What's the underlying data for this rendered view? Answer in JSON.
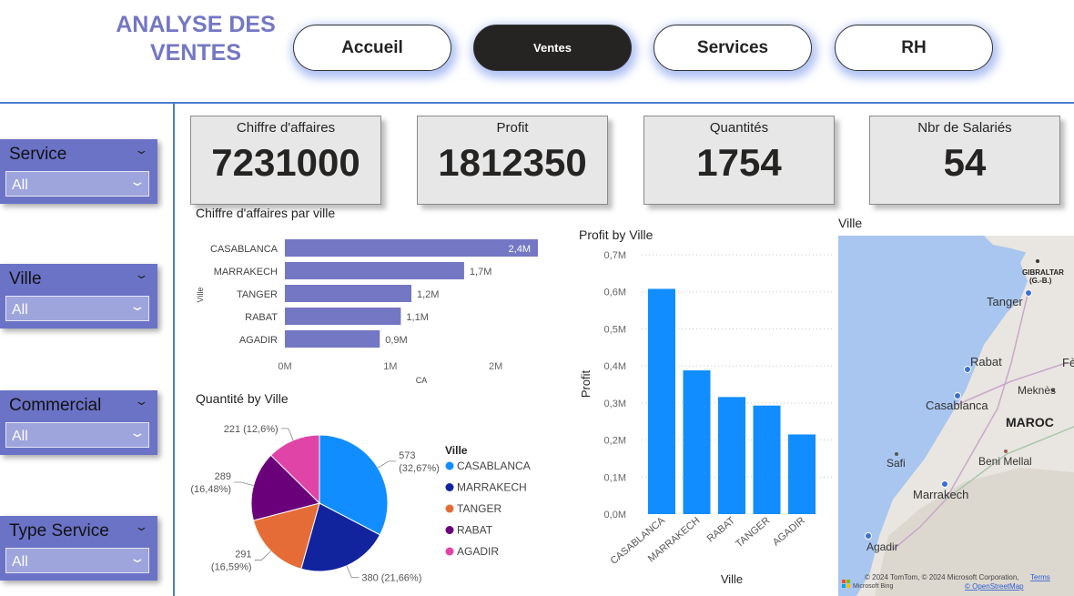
{
  "header": {
    "title": "ANALYSE DES VENTES"
  },
  "nav": [
    {
      "label": "Accueil",
      "active": false
    },
    {
      "label": "Ventes",
      "active": true
    },
    {
      "label": "Services",
      "active": false
    },
    {
      "label": "RH",
      "active": false
    }
  ],
  "slicers": [
    {
      "label": "Service",
      "value": "All"
    },
    {
      "label": "Ville",
      "value": "All"
    },
    {
      "label": "Commercial",
      "value": "All"
    },
    {
      "label": "Type Service",
      "value": "All"
    }
  ],
  "kpis": [
    {
      "label": "Chiffre d'affaires",
      "value": "7231000"
    },
    {
      "label": "Profit",
      "value": "1812350"
    },
    {
      "label": "Quantités",
      "value": "1754"
    },
    {
      "label": "Nbr de Salariés",
      "value": "54"
    }
  ],
  "colors": {
    "accent": "#6b73c7",
    "bar_ca": "#7477c4",
    "bar_profit": "#118dff",
    "border": "#4a7fcf"
  },
  "map": {
    "title": "Ville",
    "labels": {
      "gibraltar": "GIBRALTAR",
      "gibraltar_sub": "(G.-B.)",
      "tanger": "Tanger",
      "rabat": "Rabat",
      "fes": "Fè",
      "casablanca": "Casablanca",
      "meknes": "Meknès",
      "maroc": "MAROC",
      "safi": "Safi",
      "beni_mellal": "Beni Mellal",
      "marrakech": "Marrakech",
      "agadir": "Agadir"
    },
    "attribution": "© 2024 TomTom, © 2024 Microsoft Corporation,",
    "terms": "Terms",
    "osm": "© OpenStreetMap",
    "bing": "Microsoft Bing"
  },
  "chart_data": [
    {
      "type": "bar",
      "orientation": "horizontal",
      "title": "Chiffre d'affaires par ville",
      "xlabel": "CA",
      "ylabel": "Ville",
      "categories": [
        "CASABLANCA",
        "MARRAKECH",
        "TANGER",
        "RABAT",
        "AGADIR"
      ],
      "values": [
        2400000,
        1700000,
        1200000,
        1100000,
        900000
      ],
      "data_labels": [
        "2,4M",
        "1,7M",
        "1,2M",
        "1,1M",
        "0,9M"
      ],
      "xticks": [
        "0M",
        "1M",
        "2M"
      ],
      "xlim": [
        0,
        2400000
      ]
    },
    {
      "type": "pie",
      "title": "Quantité by Ville",
      "legend_title": "Ville",
      "legend_position": "right",
      "categories": [
        "CASABLANCA",
        "MARRAKECH",
        "TANGER",
        "RABAT",
        "AGADIR"
      ],
      "values": [
        573,
        380,
        291,
        289,
        221
      ],
      "colors": [
        "#118dff",
        "#12239e",
        "#e66c37",
        "#6b007b",
        "#e044a7"
      ],
      "data_labels": [
        [
          "573",
          "(32,67%)"
        ],
        [
          "380 (21,66%)"
        ],
        [
          "291",
          "(16,59%)"
        ],
        [
          "289",
          "(16,48%)"
        ],
        [
          "221 (12,6%)"
        ]
      ]
    },
    {
      "type": "bar",
      "orientation": "vertical",
      "title": "Profit by Ville",
      "xlabel": "Ville",
      "ylabel": "Profit",
      "categories": [
        "CASABLANCA",
        "MARRAKECH",
        "RABAT",
        "TANGER",
        "AGADIR"
      ],
      "values": [
        608000,
        388000,
        316000,
        293000,
        215000
      ],
      "yticks": [
        "0,0M",
        "0,1M",
        "0,2M",
        "0,3M",
        "0,4M",
        "0,5M",
        "0,6M",
        "0,7M"
      ],
      "ylim": [
        0,
        700000
      ],
      "grid": true
    }
  ]
}
